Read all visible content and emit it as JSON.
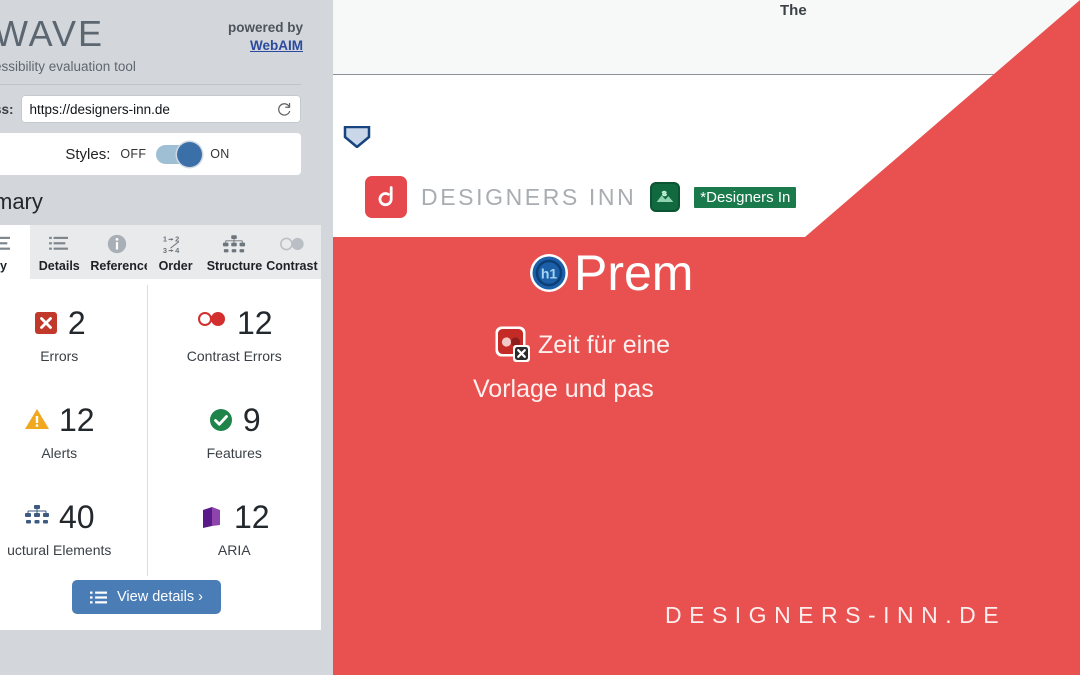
{
  "wave_panel": {
    "logo": "WAVE",
    "tagline": "essibility evaluation tool",
    "powered_by": "powered by",
    "webaim_link": "WebAIM",
    "address_label": "ss:",
    "address_value": "https://designers-inn.de",
    "address_placeholder": "https://designers-inn.de",
    "reload_icon": "reload-icon",
    "styles": {
      "label": "Styles:",
      "off_label": "OFF",
      "on_label": "ON",
      "state": "ON"
    },
    "summary_title": "mary",
    "tabs": [
      {
        "label": "ry",
        "icon": "summary-icon",
        "active": true
      },
      {
        "label": "Details",
        "icon": "list-icon",
        "active": false
      },
      {
        "label": "Reference",
        "icon": "info-icon",
        "active": false
      },
      {
        "label": "Order",
        "icon": "order-icon",
        "active": false
      },
      {
        "label": "Structure",
        "icon": "structure-icon",
        "active": false
      },
      {
        "label": "Contrast",
        "icon": "contrast-icon",
        "active": false
      }
    ],
    "stats": [
      {
        "value": "2",
        "label": "Errors",
        "icon": "error-icon",
        "color": "#c0392b"
      },
      {
        "value": "12",
        "label": "Contrast Errors",
        "icon": "contrast-icon",
        "color": "#d32f2f"
      },
      {
        "value": "12",
        "label": "Alerts",
        "icon": "alert-icon",
        "color": "#f0a820"
      },
      {
        "value": "9",
        "label": "Features",
        "icon": "feature-icon",
        "color": "#1e8449"
      },
      {
        "value": "40",
        "label": "uctural Elements",
        "icon": "structure-icon",
        "color": "#3d5a80"
      },
      {
        "value": "12",
        "label": "ARIA",
        "icon": "aria-icon",
        "color": "#6a1b9a"
      }
    ],
    "view_details_button": "View details ›",
    "view_details_icon": "list-icon"
  },
  "page": {
    "topbar_text": "The",
    "skip_icon": "skip-link-icon",
    "brand_mark_icon": "designers-inn-logo-icon",
    "brand_name": "DESIGNERS INN",
    "wave_image_icon": "linked-image-alt-icon",
    "wave_image_label": "*Designers In",
    "hero": {
      "h1_icon": "h1-heading-icon",
      "h1_text": "Prem",
      "contrast_icon": "contrast-error-icon",
      "sub_line1": "Zeit für eine",
      "sub_line2": "Vorlage und pas",
      "footer": "DESIGNERS-INN.DE"
    },
    "colors": {
      "hero_red": "#e8514f",
      "brand_red": "#e5484d",
      "wave_green": "#1a7a4c",
      "h1_blue": "#1a5fa8"
    }
  }
}
